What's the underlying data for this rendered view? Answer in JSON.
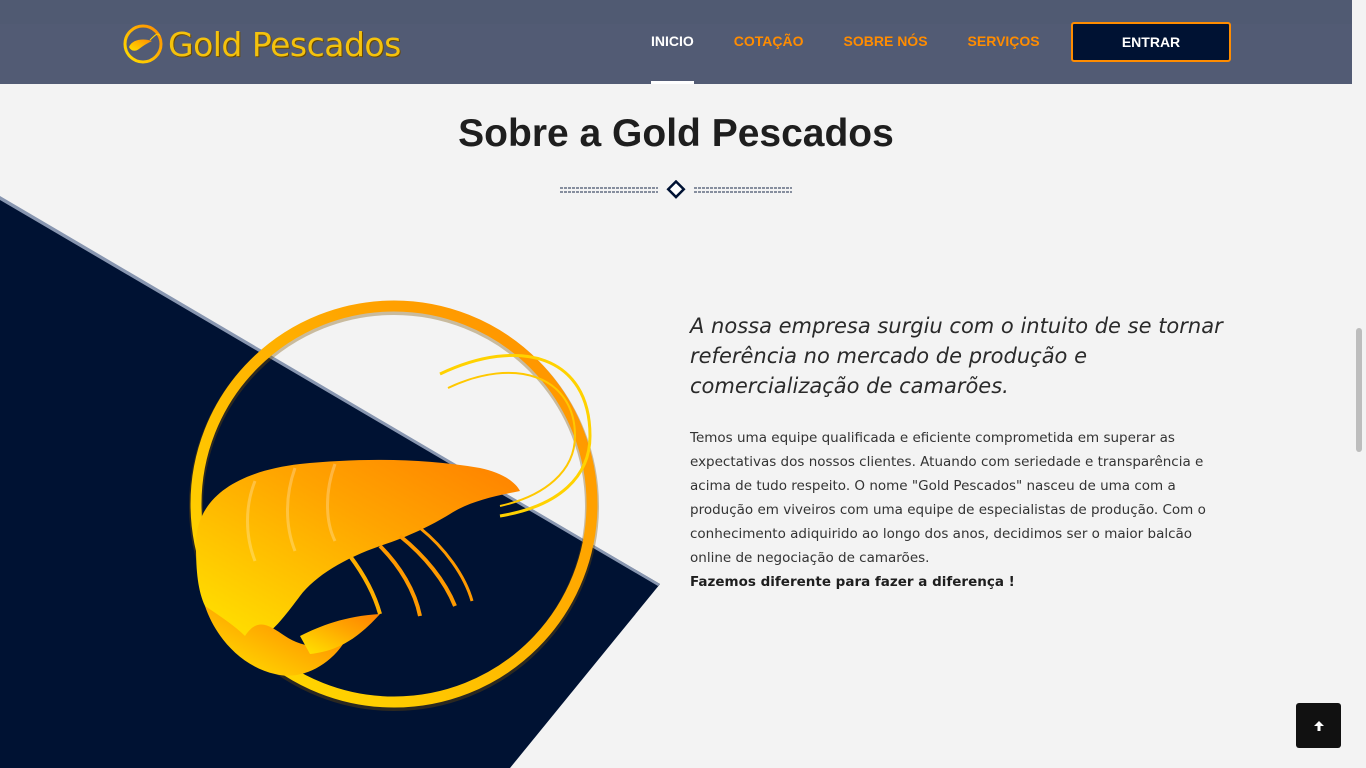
{
  "brand": {
    "name": "Gold Pescados",
    "logo_icon": "shrimp-icon"
  },
  "nav": {
    "items": [
      {
        "label": "INICIO",
        "active": true
      },
      {
        "label": "COTAÇÃO",
        "active": false
      },
      {
        "label": "SOBRE NÓS",
        "active": false
      },
      {
        "label": "SERVIÇOS",
        "active": false
      }
    ],
    "login_label": "ENTRAR"
  },
  "about": {
    "title": "Sobre a Gold Pescados",
    "lead": "A nossa empresa surgiu com o intuito de se tornar referência no mercado de produção e comercialização de camarões.",
    "body": "Temos uma equipe qualificada e eficiente comprometida em superar as expectativas dos nossos clientes. Atuando com seriedade e transparência e acima de tudo respeito. O nome \"Gold Pescados\" nasceu de uma com a produção em viveiros com uma equipe de especialistas de produção. Com o conhecimento adiquirido ao longo dos anos, decidimos ser o maior balcão online de negociação de camarões.",
    "tagline": "Fazemos diferente para fazer a diferença !"
  },
  "colors": {
    "navbar": "#525b74",
    "accent": "#ff8c00",
    "navy": "#001233",
    "gold": "#f4c20d",
    "background": "#f3f3f3"
  },
  "icons": {
    "back_to_top": "arrow-up-icon",
    "divider": "diamond-icon"
  }
}
